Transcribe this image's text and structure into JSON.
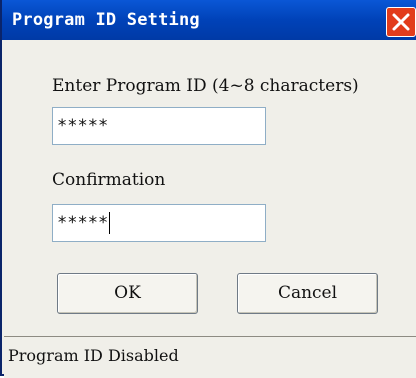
{
  "window": {
    "title": "Program ID Setting"
  },
  "form": {
    "program_id_label": "Enter Program ID (4~8 characters)",
    "program_id_value": "*****",
    "confirmation_label": "Confirmation",
    "confirmation_value": "*****"
  },
  "buttons": {
    "ok_label": "OK",
    "cancel_label": "Cancel"
  },
  "status": {
    "text": "Program ID Disabled"
  },
  "icons": {
    "close": "close-icon"
  },
  "colors": {
    "titlebar": "#0042b8",
    "close_button": "#e23c1b",
    "background": "#f0efe9"
  }
}
